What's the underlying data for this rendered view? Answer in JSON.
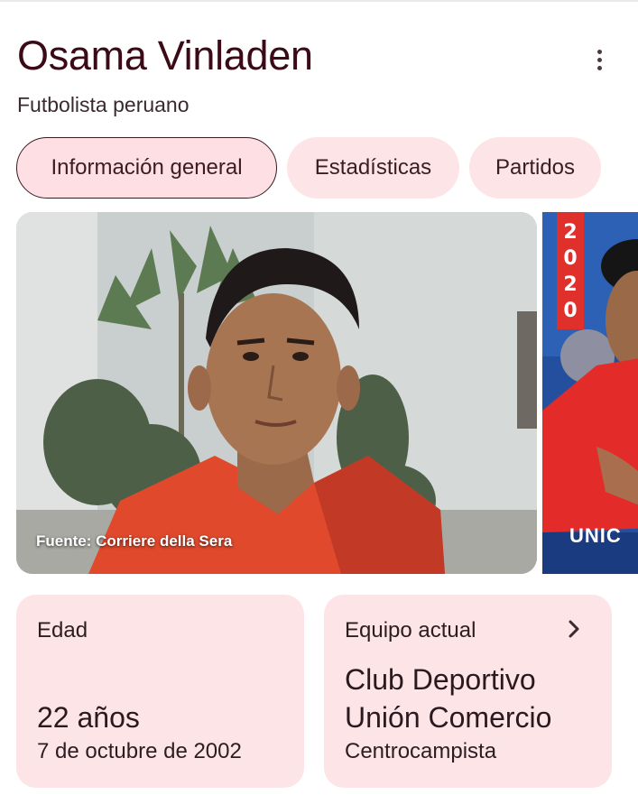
{
  "header": {
    "title": "Osama Vinladen",
    "subtitle": "Futbolista peruano",
    "menu_icon": "more-vert-icon"
  },
  "tabs": [
    {
      "label": "Información general",
      "active": true
    },
    {
      "label": "Estadísticas",
      "active": false
    },
    {
      "label": "Partidos",
      "active": false
    }
  ],
  "gallery": {
    "caption": "Fuente: Corriere della Sera",
    "second_photo_year": "2020",
    "second_photo_text": "UNIC"
  },
  "cards": {
    "age": {
      "label": "Edad",
      "value": "22 años",
      "detail": "7 de octubre de 2002"
    },
    "team": {
      "label": "Equipo actual",
      "value_line1": "Club Deportivo",
      "value_line2": "Unión Comercio",
      "detail": "Centrocampista",
      "icon": "chevron-right-icon"
    }
  },
  "colors": {
    "chip_bg": "#fde4e7",
    "card_bg": "#fde4e7",
    "title": "#3b0a16",
    "active_chip_border": "#3b1a22"
  }
}
